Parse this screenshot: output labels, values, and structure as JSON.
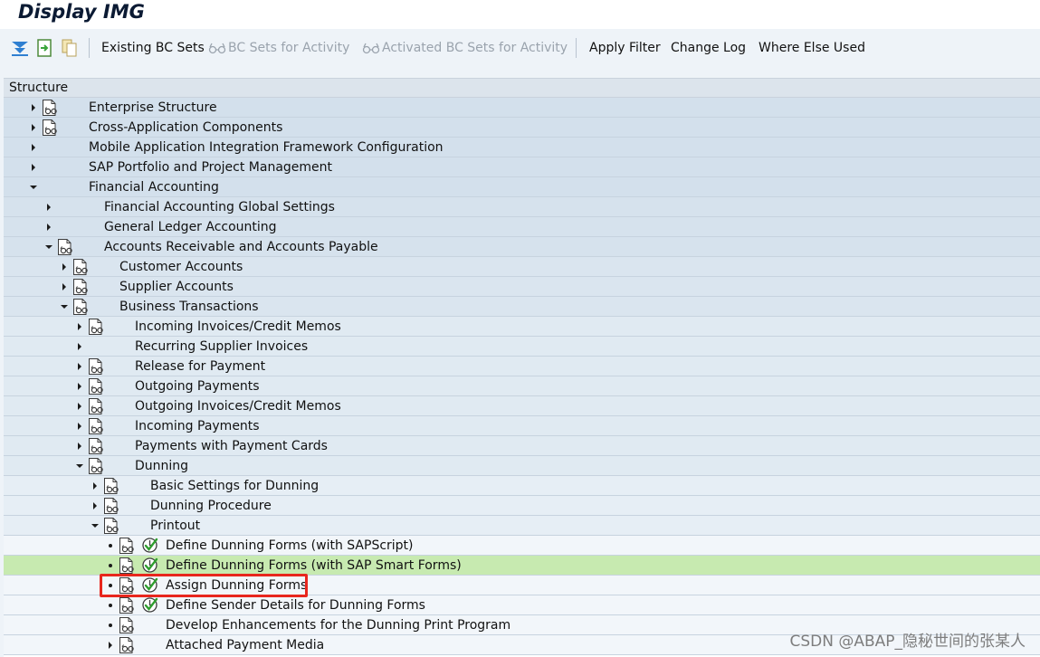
{
  "window": {
    "title": "Display IMG"
  },
  "toolbar": {
    "icons": [
      "expand-subtree-icon",
      "import-icon",
      "copy-icon"
    ],
    "buttons": [
      {
        "label": "Existing BC Sets",
        "enabled": true
      },
      {
        "label": "BC Sets for Activity",
        "enabled": false,
        "icon": "glasses-icon"
      },
      {
        "label": "Activated BC Sets for Activity",
        "enabled": false,
        "icon": "glasses-icon"
      },
      {
        "label": "Apply Filter",
        "enabled": true
      },
      {
        "label": "Change Log",
        "enabled": true
      },
      {
        "label": "Where Else Used",
        "enabled": true
      }
    ]
  },
  "tree": {
    "column_header": "Structure",
    "rows": [
      {
        "label": "Enterprise Structure",
        "level": 0,
        "state": "collapsed",
        "doc": true,
        "exec": false
      },
      {
        "label": "Cross-Application Components",
        "level": 0,
        "state": "collapsed",
        "doc": true,
        "exec": false
      },
      {
        "label": "Mobile Application Integration Framework Configuration",
        "level": 0,
        "state": "collapsed",
        "doc": false,
        "exec": false
      },
      {
        "label": "SAP Portfolio and Project Management",
        "level": 0,
        "state": "collapsed",
        "doc": false,
        "exec": false
      },
      {
        "label": "Financial Accounting",
        "level": 0,
        "state": "expanded",
        "doc": false,
        "exec": false
      },
      {
        "label": "Financial Accounting Global Settings",
        "level": 1,
        "state": "collapsed",
        "doc": false,
        "exec": false
      },
      {
        "label": "General Ledger Accounting",
        "level": 1,
        "state": "collapsed",
        "doc": false,
        "exec": false
      },
      {
        "label": "Accounts Receivable and Accounts Payable",
        "level": 1,
        "state": "expanded",
        "doc": true,
        "exec": false
      },
      {
        "label": "Customer Accounts",
        "level": 2,
        "state": "collapsed",
        "doc": true,
        "exec": false
      },
      {
        "label": "Supplier Accounts",
        "level": 2,
        "state": "collapsed",
        "doc": true,
        "exec": false
      },
      {
        "label": "Business Transactions",
        "level": 2,
        "state": "expanded",
        "doc": true,
        "exec": false
      },
      {
        "label": "Incoming Invoices/Credit Memos",
        "level": 3,
        "state": "collapsed",
        "doc": true,
        "exec": false
      },
      {
        "label": "Recurring Supplier Invoices",
        "level": 3,
        "state": "collapsed",
        "doc": false,
        "exec": false
      },
      {
        "label": "Release for Payment",
        "level": 3,
        "state": "collapsed",
        "doc": true,
        "exec": false
      },
      {
        "label": "Outgoing Payments",
        "level": 3,
        "state": "collapsed",
        "doc": true,
        "exec": false
      },
      {
        "label": "Outgoing Invoices/Credit Memos",
        "level": 3,
        "state": "collapsed",
        "doc": true,
        "exec": false
      },
      {
        "label": "Incoming Payments",
        "level": 3,
        "state": "collapsed",
        "doc": true,
        "exec": false
      },
      {
        "label": "Payments with Payment Cards",
        "level": 3,
        "state": "collapsed",
        "doc": true,
        "exec": false
      },
      {
        "label": "Dunning",
        "level": 3,
        "state": "expanded",
        "doc": true,
        "exec": false
      },
      {
        "label": "Basic Settings for Dunning",
        "level": 4,
        "state": "collapsed",
        "doc": true,
        "exec": false
      },
      {
        "label": "Dunning Procedure",
        "level": 4,
        "state": "collapsed",
        "doc": true,
        "exec": false
      },
      {
        "label": "Printout",
        "level": 4,
        "state": "expanded",
        "doc": true,
        "exec": false
      },
      {
        "label": "Define Dunning Forms (with SAPScript)",
        "level": 5,
        "state": "leaf",
        "doc": true,
        "exec": true
      },
      {
        "label": "Define Dunning Forms (with SAP Smart Forms)",
        "level": 5,
        "state": "leaf",
        "doc": true,
        "exec": true,
        "selected": true
      },
      {
        "label": "Assign Dunning Forms",
        "level": 5,
        "state": "leaf",
        "doc": true,
        "exec": true
      },
      {
        "label": "Define Sender Details for Dunning Forms",
        "level": 5,
        "state": "leaf",
        "doc": true,
        "exec": true
      },
      {
        "label": "Develop Enhancements for the Dunning Print Program",
        "level": 5,
        "state": "leaf",
        "doc": true,
        "exec": false
      },
      {
        "label": "Attached Payment Media",
        "level": 5,
        "state": "collapsed",
        "doc": true,
        "exec": false
      }
    ]
  },
  "watermark": "CSDN @ABAP_隐秘世间的张某人",
  "colors": {
    "level_backgrounds": [
      "#d3e0ec",
      "#d6e2ed",
      "#dae5ef",
      "#e0eaf2",
      "#e6eef5",
      "#f2f6fa"
    ],
    "selected_row": "#c7eab0",
    "highlight_box": "#e8271d"
  }
}
